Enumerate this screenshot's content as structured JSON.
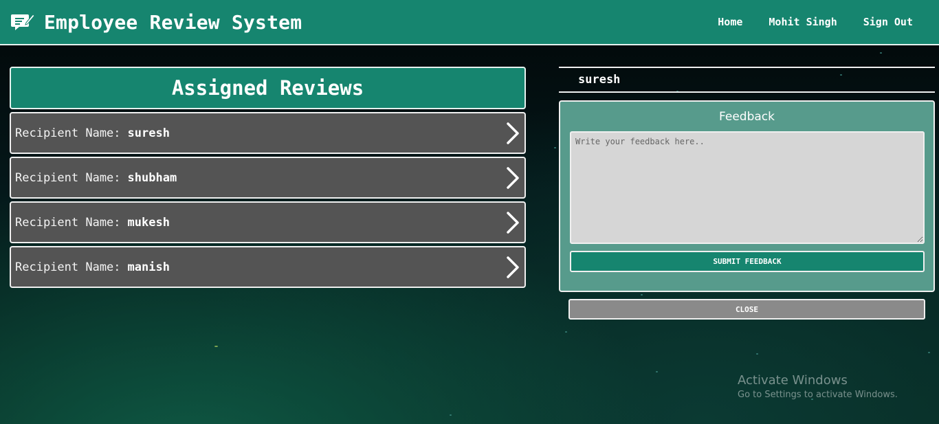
{
  "app": {
    "title": "Employee Review System"
  },
  "nav": {
    "home": "Home",
    "user": "Mohit Singh",
    "signout": "Sign Out"
  },
  "reviews": {
    "heading": "Assigned Reviews",
    "label": "Recipient Name:",
    "items": [
      {
        "name": "suresh"
      },
      {
        "name": "shubham"
      },
      {
        "name": "mukesh"
      },
      {
        "name": "manish"
      }
    ]
  },
  "feedback": {
    "recipient": "suresh",
    "title": "Feedback",
    "placeholder": "Write your feedback here..",
    "submit_label": "SUBMIT FEEDBACK",
    "close_label": "CLOSE"
  },
  "watermark": {
    "line1": "Activate Windows",
    "line2": "Go to Settings to activate Windows."
  },
  "colors": {
    "primary": "#16856f",
    "item_bg": "#545454",
    "feedback_bg": "#579b8c",
    "close_bg": "#8a8a8a"
  },
  "icons": {
    "brand": "review-edit-icon",
    "item": "chevron-right-icon"
  }
}
